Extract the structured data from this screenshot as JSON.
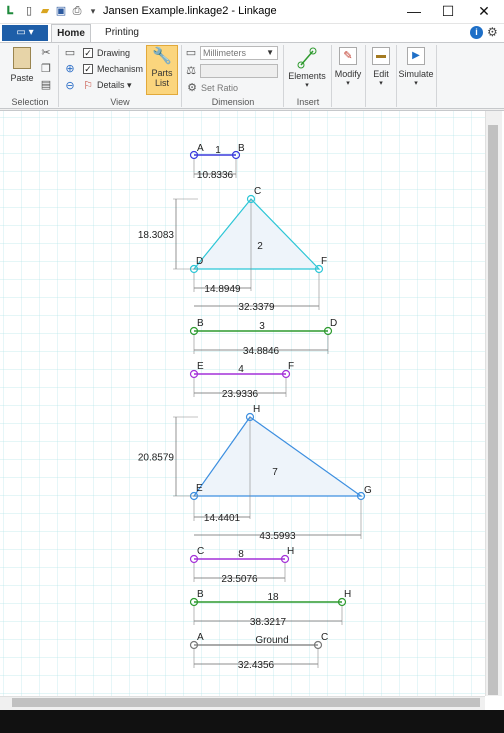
{
  "window": {
    "title": "Jansen Example.linkage2 - Linkage"
  },
  "window_controls": {
    "minimize": "—",
    "maximize": "☐",
    "close": "✕"
  },
  "tabs": {
    "app": "▭ ▾",
    "home": "Home",
    "printing": "Printing"
  },
  "ribbon": {
    "selection": {
      "label": "Selection",
      "paste": "Paste"
    },
    "view": {
      "label": "View",
      "drawing": "Drawing",
      "mechanism": "Mechanism",
      "details": "Details ▾",
      "drawing_checked": true,
      "mechanism_checked": true
    },
    "parts_list": {
      "line1": "Parts",
      "line2": "List"
    },
    "dimension": {
      "label": "Dimension",
      "units": "Millimeters",
      "set_ratio": "Set Ratio"
    },
    "insert": {
      "label": "Insert",
      "elements": "Elements"
    },
    "modify": "Modify",
    "edit": "Edit",
    "simulate": "Simulate"
  },
  "colors": {
    "blue_link": "#3a3adb",
    "cyan": "#2cc6d6",
    "green": "#2e9a2e",
    "purple": "#a431d8",
    "tri_blue": "#3d8fe0",
    "grid": "#b7e6ea"
  },
  "parts": [
    {
      "id": "1",
      "joints": [
        "A",
        "B"
      ],
      "dims": [
        "10.8336"
      ]
    },
    {
      "id": "2",
      "joints": [
        "C",
        "D",
        "F"
      ],
      "dims": [
        "18.3083",
        "14.8949",
        "32.3379"
      ]
    },
    {
      "id": "3",
      "joints": [
        "B",
        "D"
      ],
      "dims": [
        "34.8846"
      ]
    },
    {
      "id": "4",
      "joints": [
        "E",
        "F"
      ],
      "dims": [
        "23.9336"
      ]
    },
    {
      "id": "7",
      "joints": [
        "H",
        "E",
        "G"
      ],
      "dims": [
        "20.8579",
        "14.4401",
        "43.5993"
      ]
    },
    {
      "id": "8",
      "joints": [
        "C",
        "H"
      ],
      "dims": [
        "23.5076"
      ]
    },
    {
      "id": "18",
      "joints": [
        "B",
        "H"
      ],
      "dims": [
        "38.3217"
      ]
    },
    {
      "id": "Ground",
      "joints": [
        "A",
        "C"
      ],
      "dims": [
        "32.4356"
      ]
    }
  ]
}
